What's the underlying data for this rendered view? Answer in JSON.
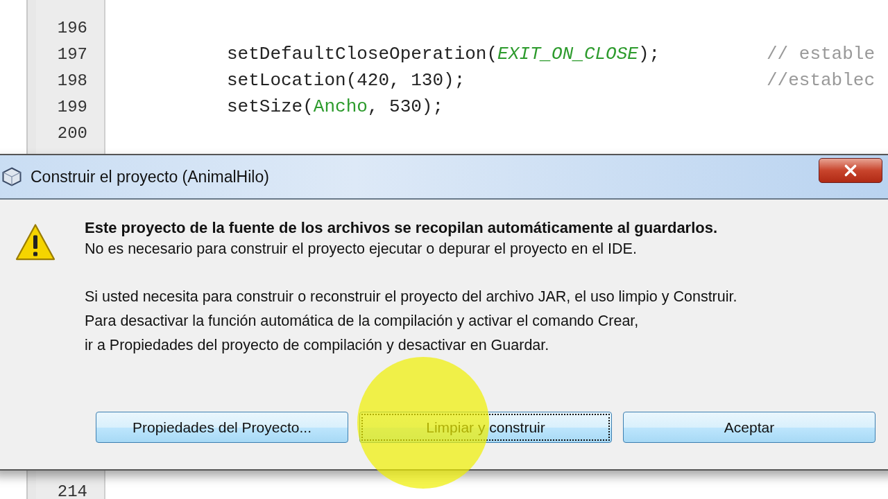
{
  "editor": {
    "top_lines": [
      {
        "number": "196"
      },
      {
        "number": "197",
        "segments": [
          {
            "kind": "code",
            "text": "setDefaultCloseOperation("
          },
          {
            "kind": "constant",
            "text": "EXIT_ON_CLOSE"
          },
          {
            "kind": "code",
            "text": ");"
          }
        ],
        "comment": "// estable"
      },
      {
        "number": "198",
        "segments": [
          {
            "kind": "code",
            "text": "setLocation(420, 130);"
          }
        ],
        "comment": "//establec"
      },
      {
        "number": "199",
        "segments": [
          {
            "kind": "code",
            "text": "setSize("
          },
          {
            "kind": "field",
            "text": "Ancho"
          },
          {
            "kind": "code",
            "text": ", 530);"
          }
        ]
      },
      {
        "number": "200"
      }
    ],
    "bottom_lines": [
      {
        "number": "214"
      }
    ]
  },
  "dialog": {
    "title": "Construir el proyecto (AnimalHilo)",
    "heading": "Este proyecto de la fuente de los archivos se recopilan automáticamente al guardarlos.",
    "paragraphs": [
      [
        "No es necesario para construir el proyecto ejecutar o depurar el proyecto en el IDE."
      ],
      [
        "Si usted necesita para construir o reconstruir el proyecto del archivo JAR, el uso limpio y Construir.",
        "Para desactivar la función automática de la compilación y activar el comando Crear,",
        "ir a Propiedades del proyecto de compilación y desactivar en Guardar."
      ]
    ],
    "buttons": [
      {
        "label": "Propiedades del Proyecto...",
        "focused": false
      },
      {
        "label": "Limpiar y construir",
        "focused": true
      },
      {
        "label": "Aceptar",
        "focused": false
      }
    ]
  }
}
